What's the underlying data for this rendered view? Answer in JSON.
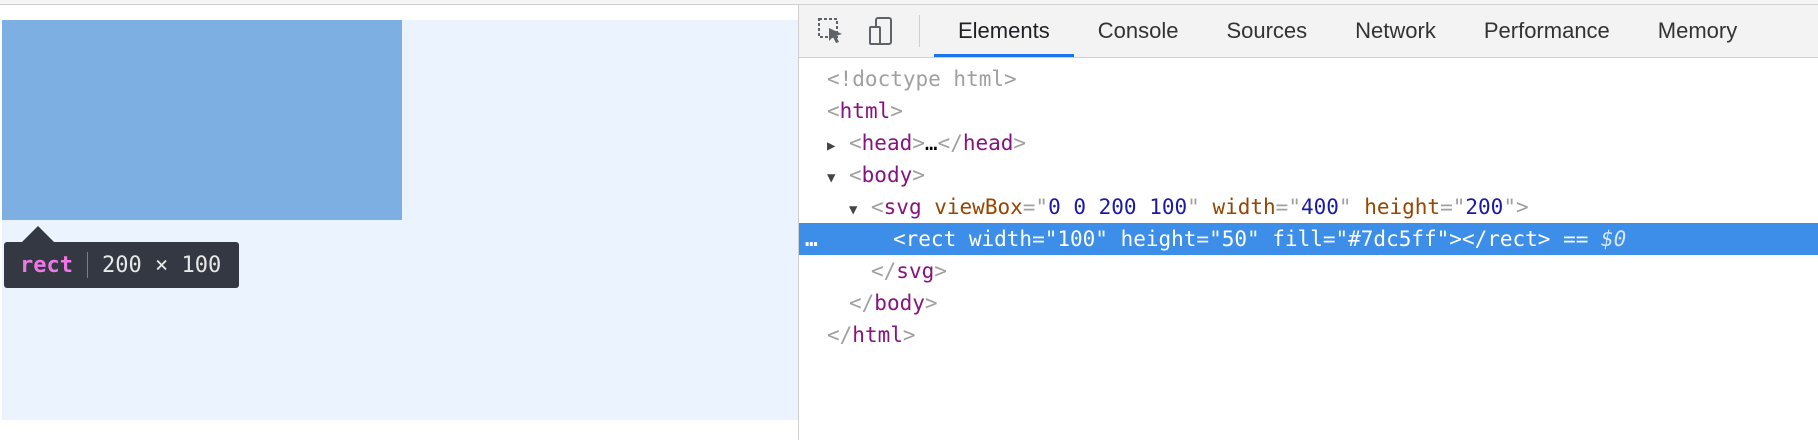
{
  "tooltip": {
    "tag": "rect",
    "size": "200 × 100"
  },
  "toolbar": {
    "tabs": [
      "Elements",
      "Console",
      "Sources",
      "Network",
      "Performance",
      "Memory"
    ],
    "active_tab": "Elements"
  },
  "icons": {
    "inspect": "inspect-element-icon",
    "device": "device-toolbar-icon"
  },
  "colors": {
    "rect_fill": "#7dafe2",
    "svg_bg": "#eaf3fe",
    "selection": "#3d8ee8",
    "active_tab": "#1a73e8"
  },
  "tree": {
    "doctype": "<!doctype html>",
    "html_open": "html",
    "head": "head",
    "head_ellipsis": "…",
    "body": "body",
    "svg_tag": "svg",
    "svg_viewbox_attr": "viewBox",
    "svg_viewbox_val": "0 0 200 100",
    "svg_width_attr": "width",
    "svg_width_val": "400",
    "svg_height_attr": "height",
    "svg_height_val": "200",
    "rect_text": "<rect width=\"100\" height=\"50\" fill=\"#7dc5ff\"></rect>",
    "rect_suffix": " == ",
    "rect_dollar": "$0",
    "dots": "…",
    "svg_close": "svg",
    "body_close": "body",
    "html_close": "html"
  }
}
